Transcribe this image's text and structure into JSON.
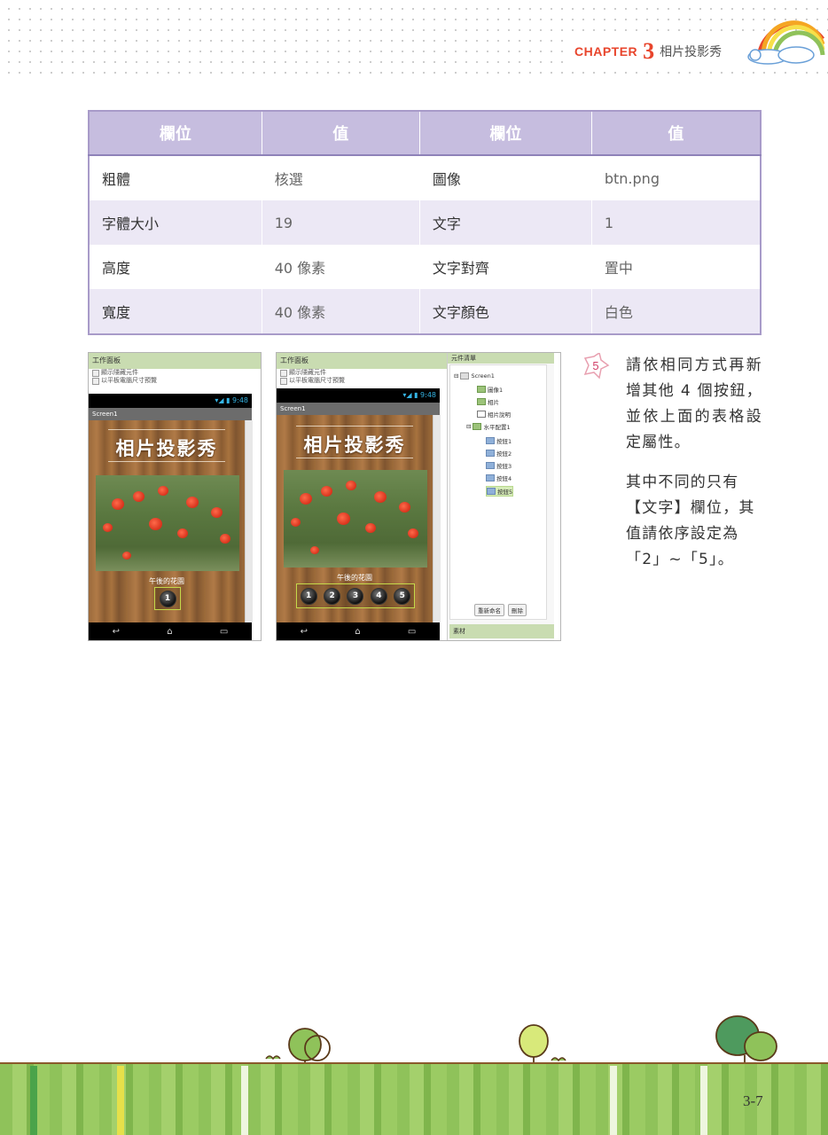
{
  "header": {
    "chapter_label": "CHAPTER",
    "chapter_number": "3",
    "chapter_title": "相片投影秀"
  },
  "property_table": {
    "headers": [
      "欄位",
      "值",
      "欄位",
      "值"
    ],
    "rows": [
      [
        "粗體",
        "核選",
        "圖像",
        "btn.png"
      ],
      [
        "字體大小",
        "19",
        "文字",
        "1"
      ],
      [
        "高度",
        "40 像素",
        "文字對齊",
        "置中"
      ],
      [
        "寬度",
        "40 像素",
        "文字顏色",
        "白色"
      ]
    ]
  },
  "screenshot_left": {
    "panel_title": "工作面板",
    "option1": "顯示隱藏元件",
    "option2": "以平板電腦尺寸預覽",
    "status_time": "9:48",
    "screen_name": "Screen1",
    "app_title": "相片投影秀",
    "caption": "午後的花園",
    "buttons": [
      "1"
    ]
  },
  "screenshot_right": {
    "panel_title": "工作面板",
    "option1": "顯示隱藏元件",
    "option2": "以平板電腦尺寸預覽",
    "status_time": "9:48",
    "screen_name": "Screen1",
    "app_title": "相片投影秀",
    "caption": "午後的花園",
    "buttons": [
      "1",
      "2",
      "3",
      "4",
      "5"
    ],
    "tree_title": "元件清單",
    "tree": {
      "screen": "Screen1",
      "image": "圖像1",
      "photo": "相片",
      "label": "相片說明",
      "arrangement": "水平配置1",
      "btn1": "按鈕1",
      "btn2": "按鈕2",
      "btn3": "按鈕3",
      "btn4": "按鈕4",
      "btn5": "按鈕5"
    },
    "rename_button": "重新命名",
    "delete_button": "刪除",
    "media_title": "素材"
  },
  "step": {
    "number": "5",
    "text1": "請依相同方式再新增其他 4 個按鈕，並依上面的表格設定屬性。",
    "text2": "其中不同的只有【文字】欄位，其值請依序設定為「2」~「5」。"
  },
  "footer": {
    "page_number": "3-7"
  },
  "colors": {
    "table_header": "#c6bddf",
    "table_stripe": "#ece8f5",
    "chapter_red": "#e8452c",
    "panel_green": "#c9dcb1",
    "footer_green": "#8fc25a"
  }
}
